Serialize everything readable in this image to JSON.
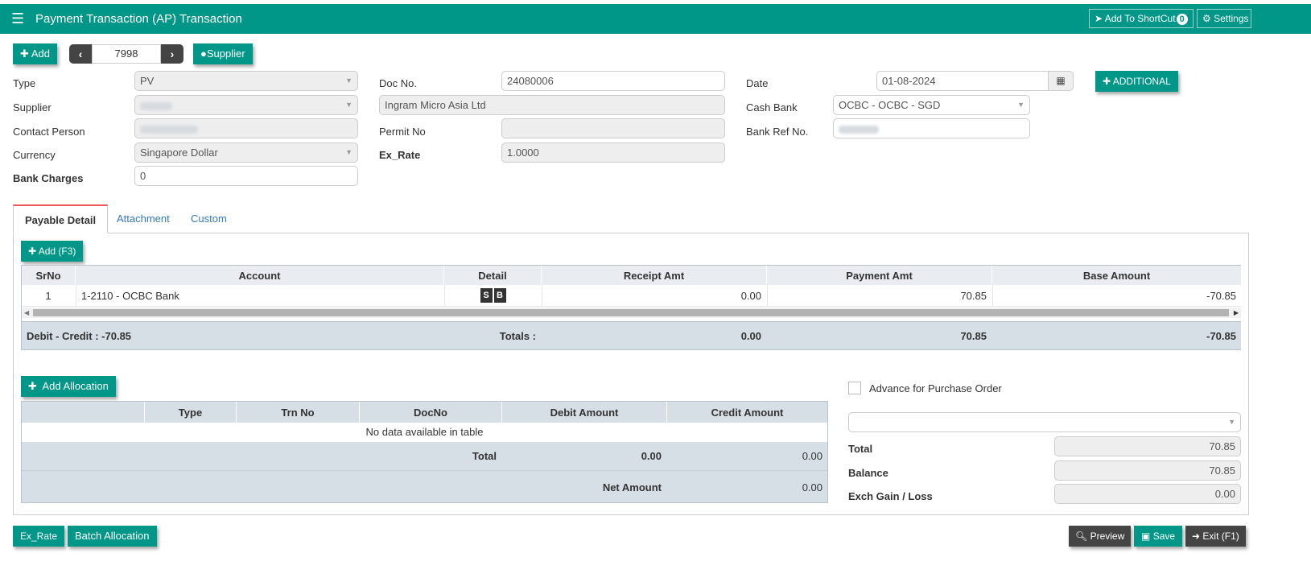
{
  "header": {
    "title": "Payment Transaction (AP) Transaction",
    "add_shortcut_label": "Add To ShortCut",
    "shortcut_count": "0",
    "settings_label": "Settings"
  },
  "toolbar": {
    "add_label": "Add",
    "record_number": "7998",
    "supplier_label": "Supplier",
    "additional_label": "ADDITIONAL"
  },
  "form": {
    "type_label": "Type",
    "type_value": "PV",
    "supplier_label": "Supplier",
    "supplier_name": "Ingram Micro Asia Ltd",
    "contact_label": "Contact Person",
    "currency_label": "Currency",
    "currency_value": "Singapore Dollar",
    "bank_charges_label": "Bank Charges",
    "bank_charges_value": "0",
    "doc_no_label": "Doc No.",
    "doc_no_value": "24080006",
    "permit_label": "Permit No",
    "permit_value": "",
    "ex_rate_label": "Ex_Rate",
    "ex_rate_value": "1.0000",
    "date_label": "Date",
    "date_value": "01-08-2024",
    "cash_bank_label": "Cash Bank",
    "cash_bank_value": "OCBC - OCBC - SGD",
    "bank_ref_label": "Bank Ref No."
  },
  "tabs": {
    "payable_detail": "Payable Detail",
    "attachment": "Attachment",
    "custom": "Custom"
  },
  "payable": {
    "add_label": "Add (F3)",
    "columns": {
      "srno": "SrNo",
      "account": "Account",
      "detail": "Detail",
      "receipt": "Receipt Amt",
      "payment": "Payment Amt",
      "base": "Base Amount"
    },
    "row": {
      "srno": "1",
      "account": "1-2110 - OCBC Bank",
      "detail_s": "S",
      "detail_b": "B",
      "receipt": "0.00",
      "payment": "70.85",
      "base": "-70.85"
    },
    "footer": {
      "debit_credit": "Debit - Credit : -70.85",
      "totals_label": "Totals :",
      "receipt_total": "0.00",
      "payment_total": "70.85",
      "base_total": "-70.85"
    }
  },
  "allocation": {
    "add_label": "Add Allocation",
    "columns": {
      "type": "Type",
      "trn_no": "Trn No",
      "doc_no": "DocNo",
      "debit": "Debit Amount",
      "credit": "Credit Amount"
    },
    "empty_text": "No data available in table",
    "total_label": "Total",
    "debit_total": "0.00",
    "credit_total": "0.00",
    "net_amount_label": "Net Amount",
    "net_amount_value": "0.00"
  },
  "summary": {
    "advance_label": "Advance for Purchase Order",
    "total_label": "Total",
    "total_value": "70.85",
    "balance_label": "Balance",
    "balance_value": "70.85",
    "exch_label": "Exch Gain / Loss",
    "exch_value": "0.00"
  },
  "footer": {
    "ex_rate_label": "Ex_Rate",
    "batch_label": "Batch Allocation",
    "preview_label": "Preview",
    "save_label": "Save",
    "exit_label": "Exit (F1)"
  },
  "colors": {
    "primary": "#009688",
    "dark_button": "#444444",
    "grid_header": "#e9edf1",
    "active_tab_accent": "#ee5555"
  }
}
